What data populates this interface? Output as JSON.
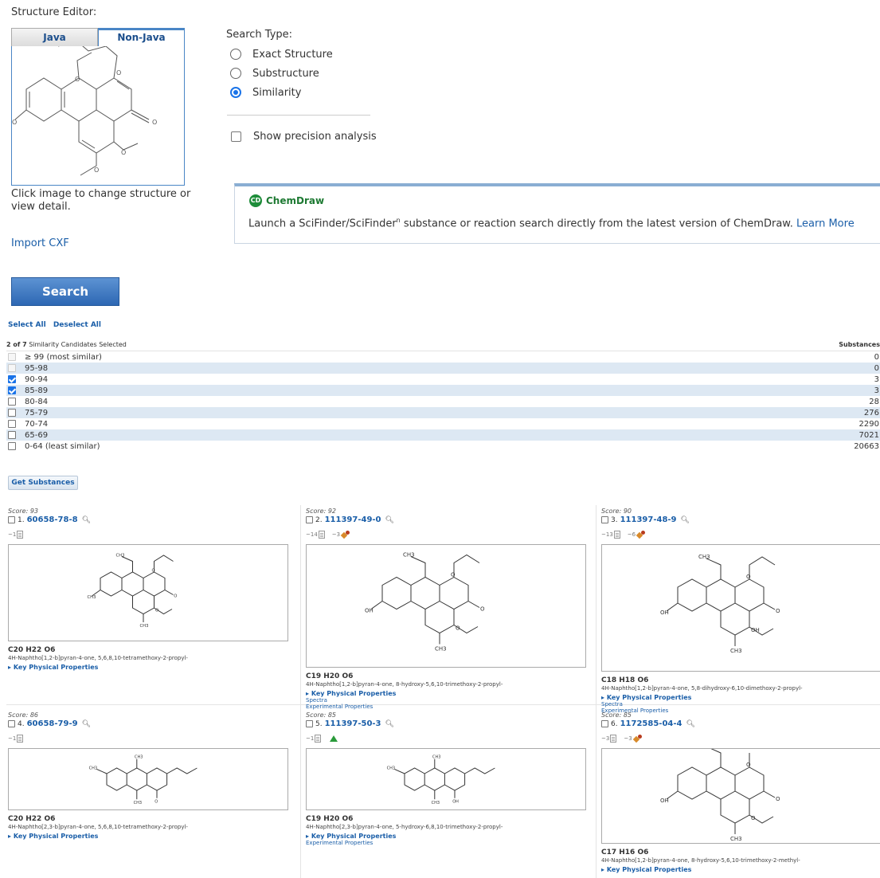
{
  "structure_editor": {
    "title": "Structure Editor:",
    "tabs": [
      {
        "label": "Java"
      },
      {
        "label": "Non-Java"
      }
    ],
    "caption": "Click image to change structure or view detail.",
    "import_link": "Import CXF"
  },
  "search_type": {
    "title": "Search Type:",
    "options": [
      {
        "label": "Exact Structure",
        "selected": false
      },
      {
        "label": "Substructure",
        "selected": false
      },
      {
        "label": "Similarity",
        "selected": true
      }
    ],
    "precision_label": "Show precision analysis"
  },
  "chemdraw": {
    "logo_text": "ChemDraw",
    "logo_icon": "CD",
    "text_before": "Launch a SciFinder/SciFinder",
    "sup": "n",
    "text_after": " substance or reaction search directly from the latest version of ChemDraw. ",
    "learn_more": "Learn More"
  },
  "search_button": "Search",
  "select_all": "Select All",
  "deselect_all": "Deselect All",
  "similarity": {
    "summary_bold": "2 of 7",
    "summary_rest": " Similarity Candidates Selected",
    "substances_header": "Substances",
    "rows": [
      {
        "range": "≥ 99 (most similar)",
        "count": "0",
        "checked": false,
        "disabled": true
      },
      {
        "range": "95-98",
        "count": "0",
        "checked": false,
        "disabled": true
      },
      {
        "range": "90-94",
        "count": "3",
        "checked": true,
        "disabled": false
      },
      {
        "range": "85-89",
        "count": "3",
        "checked": true,
        "disabled": false
      },
      {
        "range": "80-84",
        "count": "28",
        "checked": false,
        "disabled": false
      },
      {
        "range": "75-79",
        "count": "276",
        "checked": false,
        "disabled": false
      },
      {
        "range": "70-74",
        "count": "2290",
        "checked": false,
        "disabled": false
      },
      {
        "range": "65-69",
        "count": "7021",
        "checked": false,
        "disabled": false
      },
      {
        "range": "0-64 (least similar)",
        "count": "20663",
        "checked": false,
        "disabled": false
      }
    ]
  },
  "get_substances": "Get Substances",
  "results": [
    {
      "score": "Score: 93",
      "index": "1.",
      "cas": "60658-78-8",
      "refs": "~1",
      "reactions": "",
      "formula": "C20 H22 O6",
      "name": "4H-Naphtho[1,2-b]pyran-4-one, 5,6,8,10-tetramethoxy-2-propyl-",
      "kpp": "Key Physical Properties",
      "extra": []
    },
    {
      "score": "Score: 92",
      "index": "2.",
      "cas": "111397-49-0",
      "refs": "~14",
      "reactions": "~3",
      "formula": "C19 H20 O6",
      "name": "4H-Naphtho[1,2-b]pyran-4-one, 8-hydroxy-5,6,10-trimethoxy-2-propyl-",
      "kpp": "Key Physical Properties",
      "extra": [
        "Spectra",
        "Experimental Properties"
      ]
    },
    {
      "score": "Score: 90",
      "index": "3.",
      "cas": "111397-48-9",
      "refs": "~13",
      "reactions": "~6",
      "formula": "C18 H18 O6",
      "name": "4H-Naphtho[1,2-b]pyran-4-one, 5,8-dihydroxy-6,10-dimethoxy-2-propyl-",
      "kpp": "Key Physical Properties",
      "extra": [
        "Spectra",
        "Experimental Properties"
      ]
    },
    {
      "score": "Score: 86",
      "index": "4.",
      "cas": "60658-79-9",
      "refs": "~1",
      "reactions": "",
      "formula": "C20 H22 O6",
      "name": "4H-Naphtho[2,3-b]pyran-4-one, 5,6,8,10-tetramethoxy-2-propyl-",
      "kpp": "Key Physical Properties",
      "extra": []
    },
    {
      "score": "Score: 85",
      "index": "5.",
      "cas": "111397-50-3",
      "refs": "~1",
      "reactions": "",
      "formula": "C19 H20 O6",
      "name": "4H-Naphtho[2,3-b]pyran-4-one, 5-hydroxy-6,8,10-trimethoxy-2-propyl-",
      "kpp": "Key Physical Properties",
      "extra": [
        "Experimental Properties"
      ]
    },
    {
      "score": "Score: 85",
      "index": "6.",
      "cas": "1172585-04-4",
      "refs": "~3",
      "reactions": "~3",
      "formula": "C17 H16 O6",
      "name": "4H-Naphtho[1,2-b]pyran-4-one, 8-hydroxy-5,6,10-trimethoxy-2-methyl-",
      "kpp": "Key Physical Properties",
      "extra": []
    }
  ],
  "colors": {
    "link": "#1a5ea8",
    "row_alt": "#dde8f3",
    "accent": "#4a86c6"
  }
}
